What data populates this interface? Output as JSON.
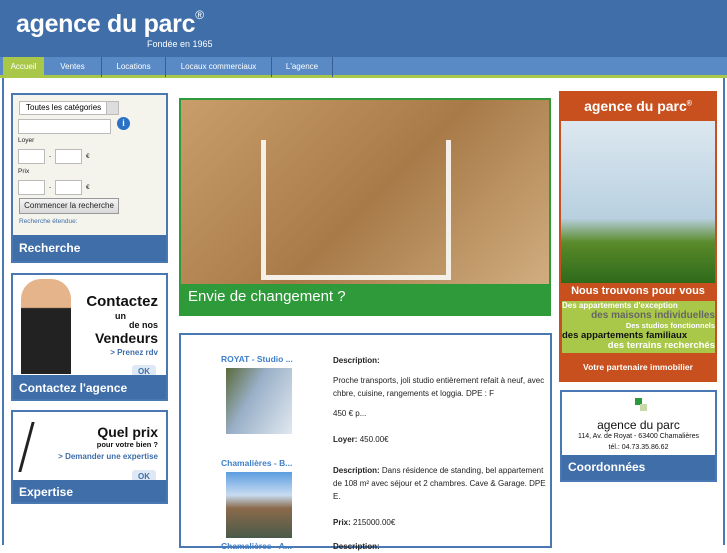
{
  "header": {
    "logo": "agence du parc",
    "reg": "®",
    "tagline": "Fondée en 1965"
  },
  "nav": [
    {
      "label": "Accueil"
    },
    {
      "label": "Ventes"
    },
    {
      "label": "Locations"
    },
    {
      "label": "Locaux commerciaux"
    },
    {
      "label": "L'agence"
    }
  ],
  "search": {
    "category": "Toutes les catégories",
    "loyer_label": "Loyer",
    "prix_label": "Prix",
    "dash": "-",
    "euro": "€",
    "button": "Commencer la recherche",
    "extended": "Recherche étendue:",
    "title": "Recherche",
    "info": "i"
  },
  "contact": {
    "line1": "Contactez",
    "line2": "un",
    "line3": "de nos",
    "line4": "Vendeurs",
    "cta": "> Prenez rdv",
    "ok": "OK",
    "title": "Contactez l'agence"
  },
  "expertise": {
    "line1": "Quel prix",
    "line2": "pour votre bien ?",
    "cta": "> Demander une expertise",
    "ok": "OK",
    "title": "Expertise"
  },
  "hero": {
    "caption": "Envie de changement ?"
  },
  "listings": [
    {
      "title": "ROYAT - Studio ...",
      "desc_label": "Description:",
      "desc": "Proche transports, joli studio entièrement refait à neuf, avec chbre, cuisine, rangements et loggia. DPE :  F",
      "extra": "450 € p...",
      "price_label": "Loyer:",
      "price": "450.00€"
    },
    {
      "title": "Chamalières - B...",
      "desc_label": "Description:",
      "desc": "Dans résidence de standing, bel appartement de 108 m² avec séjour et 2 chambres. Cave & Garage. DPE E.",
      "price_label": "Prix:",
      "price": "215000.00€"
    },
    {
      "title": "Chamalières - A...",
      "desc_label": "Description:"
    }
  ],
  "ad": {
    "logo": "agence du parc",
    "reg": "®",
    "headline": "Nous trouvons pour vous",
    "l1": "Des appartements d'exception",
    "l2": "des maisons individuelles",
    "l3": "Des studios fonctionnels",
    "l4": "des appartements familiaux",
    "l5": "des terrains recherchés",
    "footer": "Votre partenaire immobilier"
  },
  "coords": {
    "name": "agence du parc",
    "address": "114, Av. de Royat - 63400 Chamalières",
    "phone": "tél.: 04.73.35.86.62",
    "title": "Coordonnées"
  }
}
